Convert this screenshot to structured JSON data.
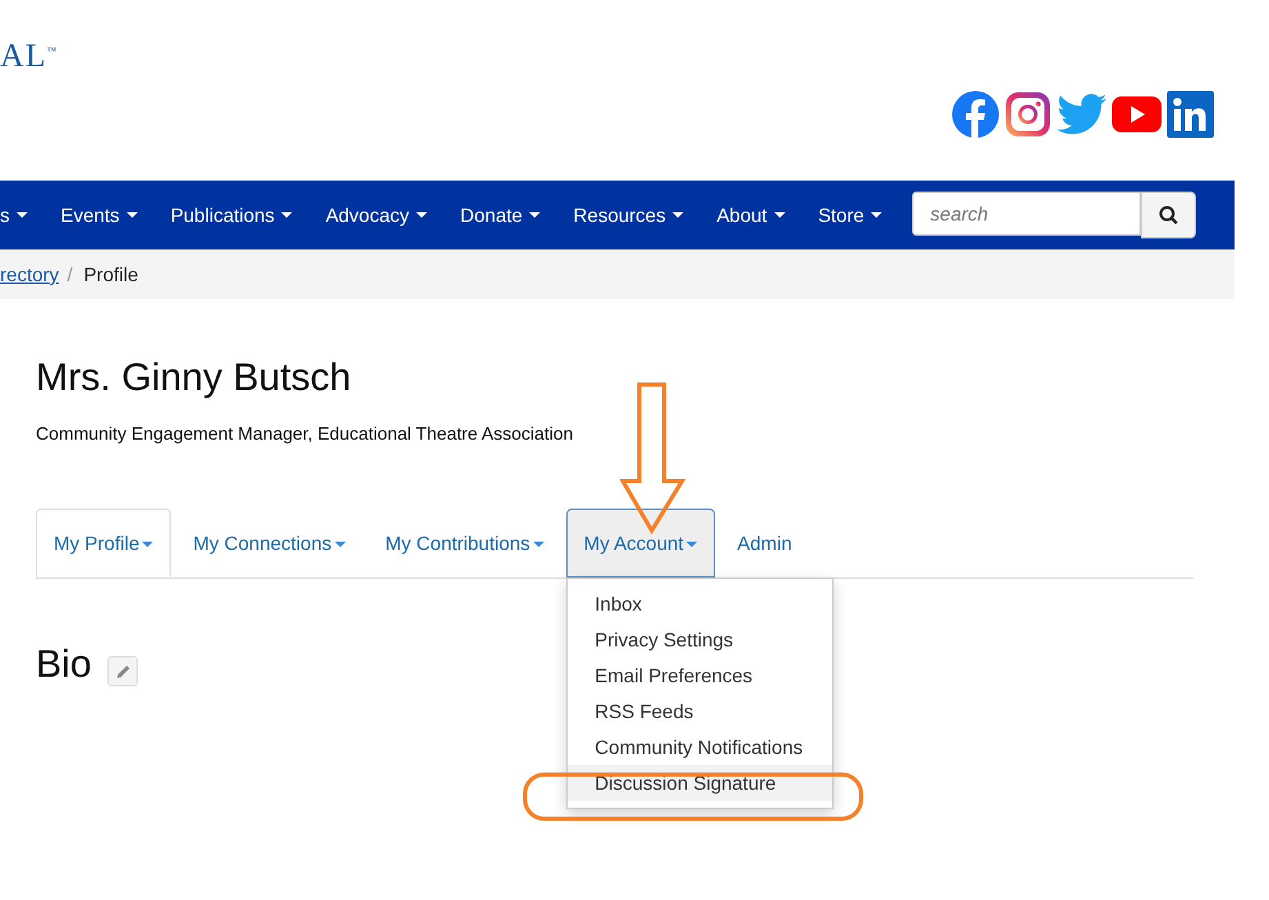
{
  "logo": {
    "text": "AL",
    "mark": "™"
  },
  "social": [
    {
      "kind": "facebook"
    },
    {
      "kind": "instagram"
    },
    {
      "kind": "twitter"
    },
    {
      "kind": "youtube"
    },
    {
      "kind": "linkedin"
    }
  ],
  "nav": [
    {
      "label": "s"
    },
    {
      "label": "Events"
    },
    {
      "label": "Publications"
    },
    {
      "label": "Advocacy"
    },
    {
      "label": "Donate"
    },
    {
      "label": "Resources"
    },
    {
      "label": "About"
    },
    {
      "label": "Store"
    }
  ],
  "search": {
    "placeholder": "search"
  },
  "breadcrumb_separator": "/",
  "breadcrumb": [
    {
      "label": "rectory",
      "link": true
    },
    {
      "label": "Profile",
      "link": false
    }
  ],
  "profile": {
    "name": "Mrs. Ginny Butsch",
    "title": "Community Engagement Manager, Educational Theatre Association"
  },
  "tabs": [
    {
      "label": "My Profile",
      "caret": true,
      "selected": true,
      "open": false
    },
    {
      "label": "My Connections",
      "caret": true,
      "selected": false,
      "open": false
    },
    {
      "label": "My Contributions",
      "caret": true,
      "selected": false,
      "open": false
    },
    {
      "label": "My Account",
      "caret": true,
      "selected": false,
      "open": true
    },
    {
      "label": "Admin",
      "caret": false,
      "selected": false,
      "open": false
    }
  ],
  "menu": [
    {
      "label": "Inbox",
      "highlighted": false
    },
    {
      "label": "Privacy Settings",
      "highlighted": false
    },
    {
      "label": "Email Preferences",
      "highlighted": false
    },
    {
      "label": "RSS Feeds",
      "highlighted": false
    },
    {
      "label": "Community Notifications",
      "highlighted": false
    },
    {
      "label": "Discussion Signature",
      "highlighted": true
    }
  ],
  "section": {
    "heading": "Bio"
  }
}
